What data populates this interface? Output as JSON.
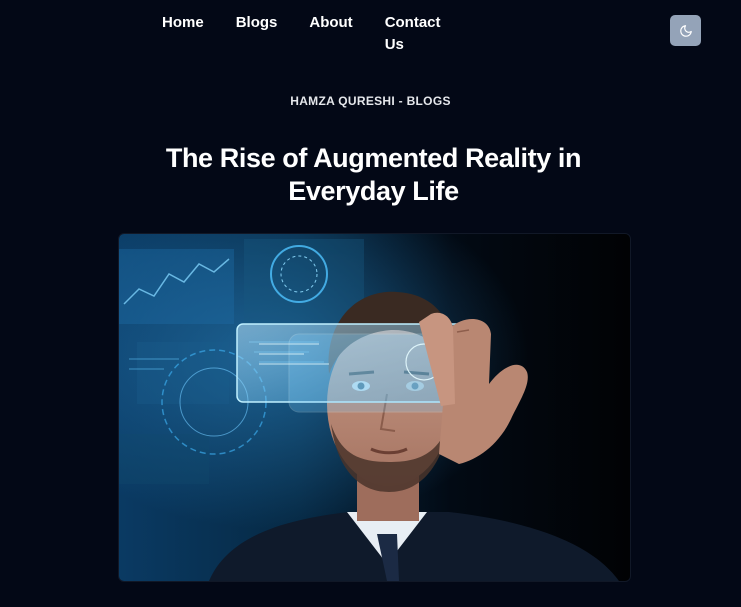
{
  "nav": {
    "items": [
      {
        "label": "Home"
      },
      {
        "label": "Blogs"
      },
      {
        "label": "About"
      },
      {
        "label": "Contact Us"
      }
    ]
  },
  "theme_toggle": {
    "icon": "moon-icon"
  },
  "post": {
    "kicker": "HAMZA QURESHI - BLOGS",
    "title": "The Rise of Augmented Reality in Everyday Life",
    "hero_image": {
      "icon": "hero-image"
    }
  },
  "colors": {
    "background": "#030816",
    "toggle_bg": "#94a3b8",
    "text": "#ffffff",
    "hologram": "#4fc3ff"
  }
}
